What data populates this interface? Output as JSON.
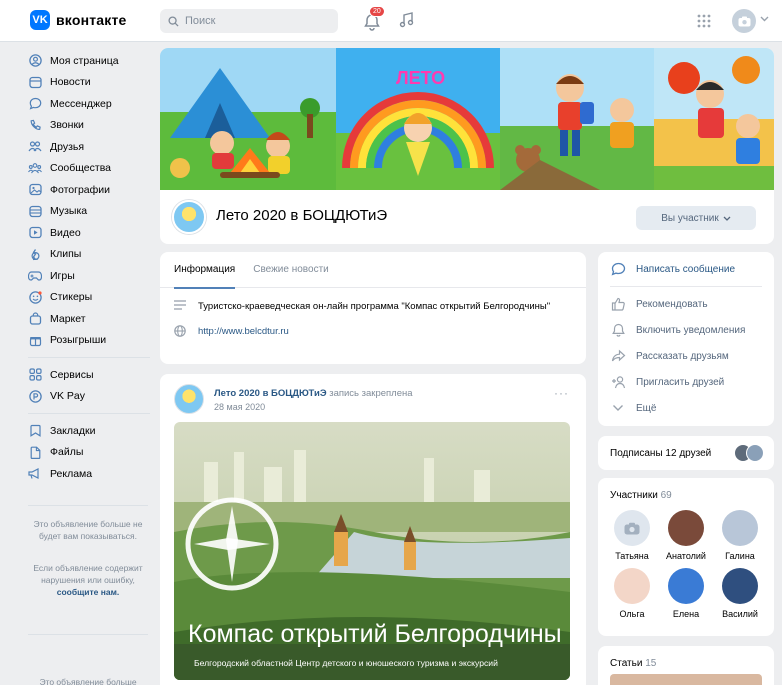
{
  "header": {
    "logo_text": "вконтакте",
    "logo_mark": "VK",
    "search_placeholder": "Поиск",
    "notifications_badge": "20"
  },
  "sidebar": {
    "items": [
      {
        "label": "Моя страница",
        "icon": "user-circle-icon"
      },
      {
        "label": "Новости",
        "icon": "news-icon"
      },
      {
        "label": "Мессенджер",
        "icon": "chat-bubble-icon"
      },
      {
        "label": "Звонки",
        "icon": "phone-icon"
      },
      {
        "label": "Друзья",
        "icon": "friends-icon"
      },
      {
        "label": "Сообщества",
        "icon": "communities-icon"
      },
      {
        "label": "Фотографии",
        "icon": "photo-icon"
      },
      {
        "label": "Музыка",
        "icon": "music-icon"
      },
      {
        "label": "Видео",
        "icon": "video-icon"
      },
      {
        "label": "Клипы",
        "icon": "clips-icon"
      },
      {
        "label": "Игры",
        "icon": "gamepad-icon"
      },
      {
        "label": "Стикеры",
        "icon": "sticker-icon"
      },
      {
        "label": "Маркет",
        "icon": "market-bag-icon"
      },
      {
        "label": "Розыгрыши",
        "icon": "gift-icon"
      }
    ],
    "items2": [
      {
        "label": "Сервисы",
        "icon": "services-icon"
      },
      {
        "label": "VK Pay",
        "icon": "vkpay-icon"
      }
    ],
    "items3": [
      {
        "label": "Закладки",
        "icon": "bookmark-icon"
      },
      {
        "label": "Файлы",
        "icon": "file-icon"
      },
      {
        "label": "Реклама",
        "icon": "megaphone-icon"
      }
    ],
    "ad_note_1": "Это объявление больше не будет вам показываться.",
    "ad_note_2": "Если объявление содержит нарушения или ошибку,",
    "ad_note_2_link": "сообщите нам.",
    "ad_note_3": "Это объявление больше"
  },
  "group": {
    "name": "Лето 2020 в БОЦДЮТиЭ",
    "member_button": "Вы участник",
    "cover_title": "ЛЕТО"
  },
  "info": {
    "tabs": [
      "Информация",
      "Свежие новости"
    ],
    "description": "Туристско-краеведческая он-лайн программа \"Компас открытий Белгородчины\"",
    "link": "http://www.belcdtur.ru"
  },
  "post": {
    "author": "Лето 2020 в БОЦДЮТиЭ",
    "pinned": "запись закреплена",
    "date": "28 мая 2020",
    "more": "···",
    "image_title": "Компас открытий Белгородчины",
    "image_subtitle": "Белгородский областной Центр детского и юношеского туризма и экскурсий"
  },
  "actions": [
    {
      "label": "Написать сообщение",
      "icon": "message-icon"
    },
    {
      "label": "Рекомендовать",
      "icon": "thumbs-up-icon"
    },
    {
      "label": "Включить уведомления",
      "icon": "bell-icon"
    },
    {
      "label": "Рассказать друзьям",
      "icon": "share-icon"
    },
    {
      "label": "Пригласить друзей",
      "icon": "invite-icon"
    },
    {
      "label": "Ещё",
      "icon": "chevron-down-icon"
    }
  ],
  "friends": {
    "label": "Подписаны 12 друзей"
  },
  "members": {
    "title": "Участники",
    "count": "69",
    "list": [
      {
        "name": "Татьяна",
        "color": "#dfe6ee"
      },
      {
        "name": "Анатолий",
        "color": "#7a4a3a"
      },
      {
        "name": "Галина",
        "color": "#b8c6d8"
      },
      {
        "name": "Ольга",
        "color": "#f3d6c8"
      },
      {
        "name": "Елена",
        "color": "#3a7bd5"
      },
      {
        "name": "Василий",
        "color": "#2f4f7f"
      }
    ]
  },
  "articles": {
    "title": "Статьи",
    "count": "15"
  }
}
